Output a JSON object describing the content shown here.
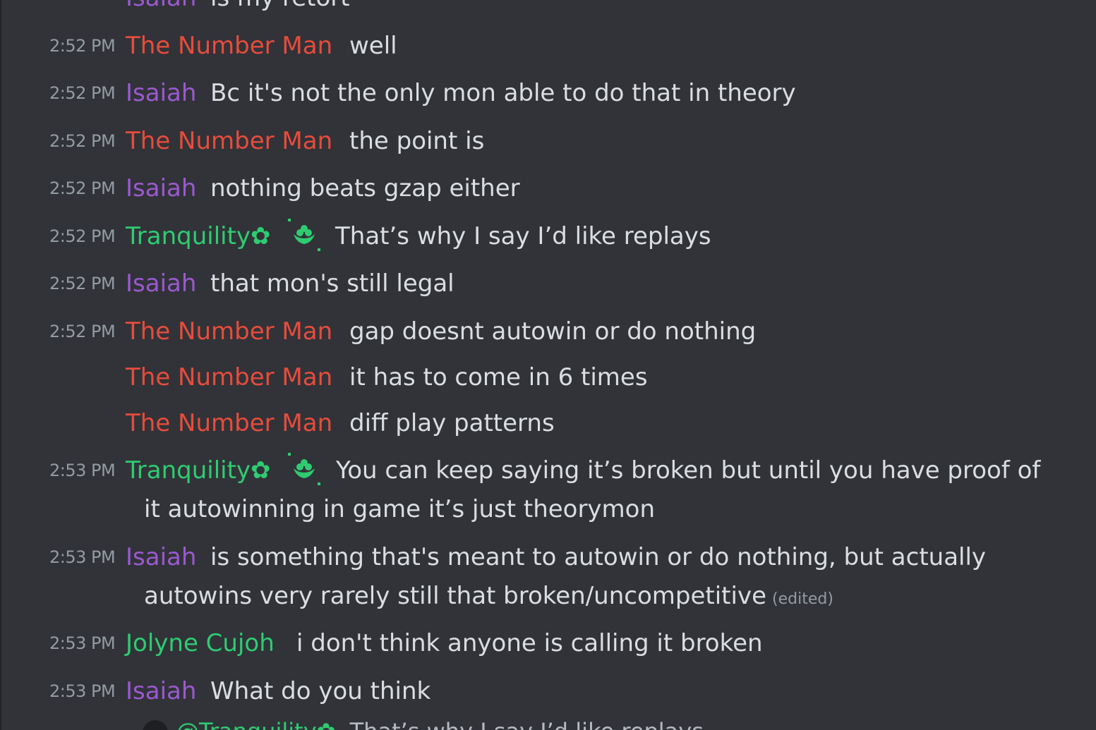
{
  "colors": {
    "background": "#313338",
    "number_man": "#e74c3c",
    "isaiah": "#9b59d0",
    "tranquility": "#2ecc71",
    "jolyne": "#2ecc71",
    "timestamp": "#949ba4",
    "text": "#dbdee1"
  },
  "top_partial": {
    "user": "Isaiah",
    "text": "is my retort"
  },
  "messages": [
    {
      "time": "2:52 PM",
      "user": "The Number Man",
      "text": "well"
    },
    {
      "time": "2:52 PM",
      "user": "Isaiah",
      "text": "Bc it's not the only mon able to do that in theory"
    },
    {
      "time": "2:52 PM",
      "user": "The Number Man",
      "text": "the point is"
    },
    {
      "time": "2:52 PM",
      "user": "Isaiah",
      "text": "nothing beats gzap either"
    },
    {
      "time": "2:52 PM",
      "user": "Tranquility✿",
      "text": "That’s why I say I’d like replays"
    },
    {
      "time": "2:52 PM",
      "user": "Isaiah",
      "text": "that mon's still legal"
    },
    {
      "time": "2:52 PM",
      "user": "The Number Man",
      "text": "gap doesnt autowin or do nothing"
    },
    {
      "time": "",
      "user": "The Number Man",
      "text": "it has to come in 6 times"
    },
    {
      "time": "",
      "user": "The Number Man",
      "text": "diff play patterns"
    },
    {
      "time": "2:53 PM",
      "user": "Tranquility✿",
      "text": "You can keep saying it’s broken but until you have proof of",
      "text2": "it autowinning in game it’s just theorymon"
    },
    {
      "time": "2:53 PM",
      "user": "Isaiah",
      "text": "is something that's meant to autowin or do nothing, but actually",
      "text2": "autowins very rarely still that broken/uncompetitive",
      "edited": "(edited)"
    },
    {
      "time": "2:53 PM",
      "user": "Jolyne Cujoh",
      "text": "i don't think anyone is calling it broken"
    },
    {
      "time": "2:53 PM",
      "user": "Isaiah",
      "text": "What do you think"
    }
  ],
  "reply_preview": {
    "mention": "@Tranquility✿",
    "text": "That’s why I say I’d like replays"
  }
}
